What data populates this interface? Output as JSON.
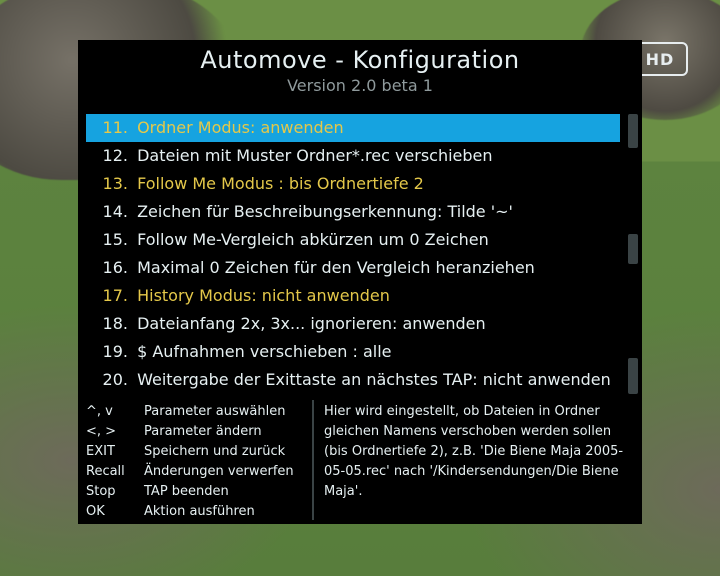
{
  "hd_badge": "HD",
  "title": "Automove  -  Konfiguration",
  "version": "Version 2.0 beta 1",
  "items": [
    {
      "n": "11.",
      "text": "Ordner Modus: anwenden",
      "selected": true,
      "highlight": true
    },
    {
      "n": "12.",
      "text": "  Dateien mit Muster Ordner*.rec verschieben",
      "selected": false,
      "highlight": false
    },
    {
      "n": "13.",
      "text": "Follow Me Modus : bis Ordnertiefe 2",
      "selected": false,
      "highlight": true
    },
    {
      "n": "14.",
      "text": "  Zeichen für Beschreibungserkennung: Tilde '~'",
      "selected": false,
      "highlight": false
    },
    {
      "n": "15.",
      "text": "  Follow Me-Vergleich abkürzen um 0 Zeichen",
      "selected": false,
      "highlight": false
    },
    {
      "n": "16.",
      "text": "  Maximal 0 Zeichen für den Vergleich heranziehen",
      "selected": false,
      "highlight": false
    },
    {
      "n": "17.",
      "text": "History Modus: nicht anwenden",
      "selected": false,
      "highlight": true
    },
    {
      "n": "18.",
      "text": "Dateianfang 2x, 3x... ignorieren: anwenden",
      "selected": false,
      "highlight": false
    },
    {
      "n": "19.",
      "text": "$ Aufnahmen verschieben : alle",
      "selected": false,
      "highlight": false
    },
    {
      "n": "20.",
      "text": "Weitergabe der Exittaste an nächstes TAP: nicht anwenden",
      "selected": false,
      "highlight": false
    }
  ],
  "keys": [
    {
      "key": "^, v",
      "desc": "Parameter auswählen"
    },
    {
      "key": "<, >",
      "desc": "Parameter ändern"
    },
    {
      "key": "EXIT",
      "desc": "Speichern und zurück"
    },
    {
      "key": "Recall",
      "desc": "Änderungen verwerfen"
    },
    {
      "key": "Stop",
      "desc": "TAP beenden"
    },
    {
      "key": "OK",
      "desc": "Aktion ausführen"
    }
  ],
  "help_text": "Hier wird eingestellt, ob Dateien in Ordner gleichen Namens verschoben werden sollen (bis Ordnertiefe 2), z.B. 'Die Biene Maja 2005-05-05.rec' nach '/Kindersendungen/Die Biene Maja'."
}
